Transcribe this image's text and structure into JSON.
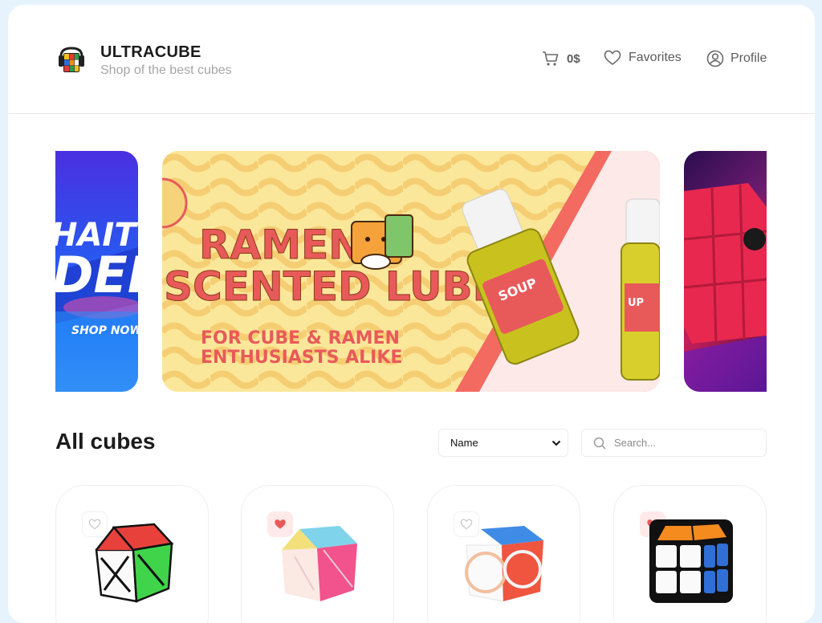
{
  "brand": {
    "title": "ULTRACUBE",
    "subtitle": "Shop of the best cubes"
  },
  "nav": {
    "cart_total": "0$",
    "favorites_label": "Favorites",
    "profile_label": "Profile"
  },
  "banner": {
    "left_lines": [
      "HAITU",
      "DEI",
      "SHOP NOW"
    ],
    "main_title_lines": [
      "RAMEN",
      "SCENTED LUBE"
    ],
    "main_subtitle_lines": [
      "FOR CUBE & RAMEN",
      "ENTHUSIASTS ALIKE"
    ],
    "bottle_label": "SOUP",
    "bottle_label_2": "UP"
  },
  "catalog": {
    "title": "All cubes",
    "sort_value": "Name",
    "search_placeholder": "Search..."
  },
  "products": [
    {
      "favorited": false,
      "icon": "axis-cube-icon"
    },
    {
      "favorited": true,
      "icon": "pastel-axis-cube-icon"
    },
    {
      "favorited": false,
      "icon": "rounded-cube-icon"
    },
    {
      "favorited": true,
      "icon": "2x3-cube-icon"
    }
  ],
  "colors": {
    "accent_red": "#e85a5a",
    "header_text": "#1c1c1c",
    "muted": "#a6a6a6",
    "page_bg": "#e6f3fc"
  }
}
